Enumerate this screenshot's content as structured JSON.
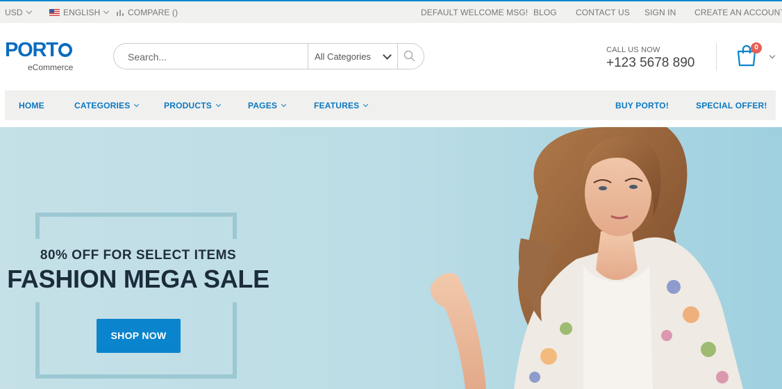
{
  "topbar": {
    "currency": "USD",
    "language": "ENGLISH",
    "compare": "COMPARE ()",
    "welcome": "DEFAULT WELCOME MSG!",
    "links": [
      "BLOG",
      "CONTACT US",
      "SIGN IN",
      "CREATE AN ACCOUNT"
    ]
  },
  "header": {
    "logo": "PORTO",
    "logo_sub": "eCommerce",
    "search_placeholder": "Search...",
    "category": "All Categories",
    "call_label": "CALL US NOW",
    "phone": "+123 5678 890",
    "cart_count": "0"
  },
  "nav": {
    "items": [
      "HOME",
      "CATEGORIES",
      "PRODUCTS",
      "PAGES",
      "FEATURES"
    ],
    "right": [
      "BUY PORTO!",
      "SPECIAL OFFER!"
    ]
  },
  "hero": {
    "subtitle": "80% OFF FOR SELECT ITEMS",
    "title": "FASHION MEGA SALE",
    "button": "SHOP NOW"
  },
  "colors": {
    "accent": "#0a84cc",
    "nav_text": "#0a78c2",
    "badge": "#e36159",
    "hero_bg": "#c5e0e7"
  }
}
